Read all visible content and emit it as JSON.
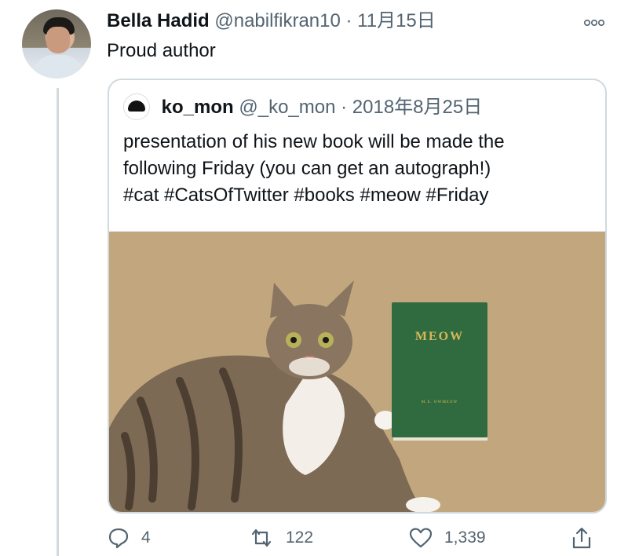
{
  "tweet": {
    "author_name": "Bella Hadid",
    "author_handle": "@nabilfikran10",
    "separator": "·",
    "date": "11月15日",
    "text": "Proud author",
    "more_icon": "more-options-icon"
  },
  "quoted_tweet": {
    "author_name": "ko_mon",
    "author_handle": "@_ko_mon",
    "separator": "·",
    "date": "2018年8月25日",
    "text_lines": [
      "presentation of his new book will be made the",
      "following Friday (you can get an autograph!)",
      "#cat #CatsOfTwitter #books  #meow #Friday"
    ],
    "image": {
      "book_title": "MEOW",
      "book_author": "M.E. OWMEOW",
      "colors": {
        "rug": "#c2a77e",
        "book": "#2f6b3e",
        "book_text": "#d8b75a"
      }
    }
  },
  "actions": {
    "reply_count": "4",
    "retweet_count": "122",
    "like_count": "1,339"
  },
  "colors": {
    "text_primary": "#0f1419",
    "text_secondary": "#536471",
    "border": "#cfd9de"
  }
}
